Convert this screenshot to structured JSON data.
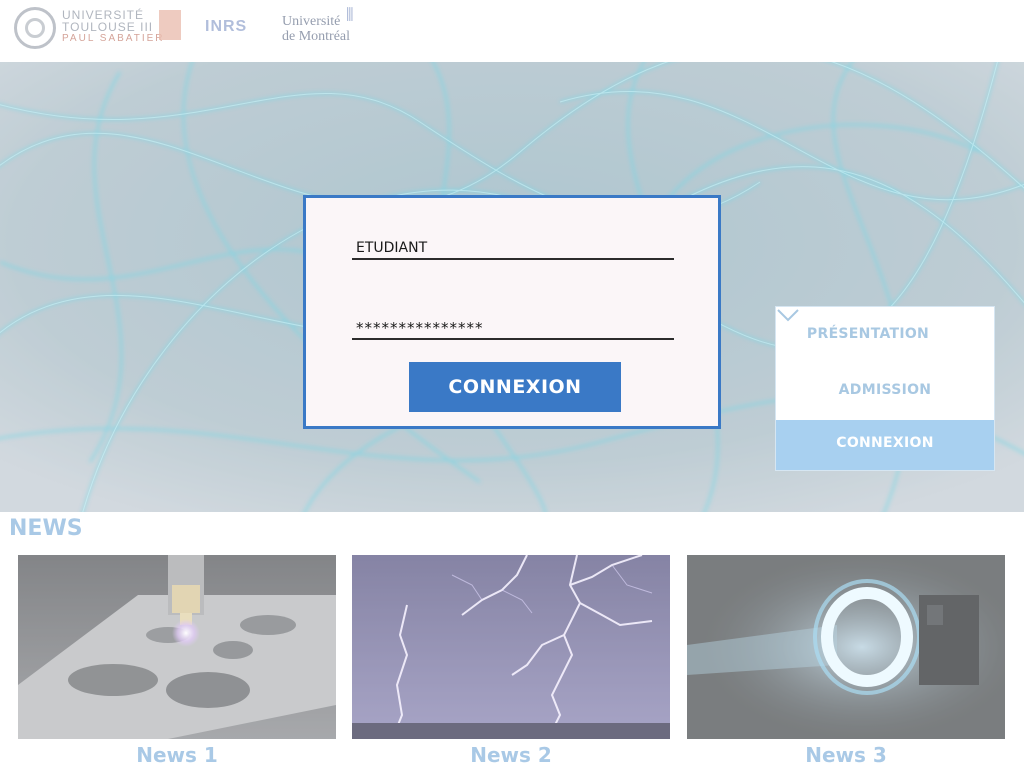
{
  "header": {
    "logos": {
      "ut3": {
        "line1": "UNIVERSITÉ",
        "line2": "TOULOUSE III",
        "line3": "PAUL SABATIER"
      },
      "inrs": {
        "text": "INRS"
      },
      "udem": {
        "line1": "Université",
        "line2": "de Montréal"
      }
    }
  },
  "login": {
    "username": "ETUDIANT",
    "password": "***************",
    "submit_label": "CONNEXION"
  },
  "menu": {
    "items": [
      {
        "label": "PRÉSENTATION",
        "icon": "chevron-down-icon"
      },
      {
        "label": "ADMISSION"
      },
      {
        "label": "CONNEXION",
        "active": true
      }
    ]
  },
  "news": {
    "heading": "NEWS",
    "items": [
      {
        "title": "News 1"
      },
      {
        "title": "News 2"
      },
      {
        "title": "News 3"
      }
    ]
  },
  "colors": {
    "accent": "#3a79c6",
    "menu_active": "#a8d0f0",
    "muted_text": "#a9c9e6"
  }
}
